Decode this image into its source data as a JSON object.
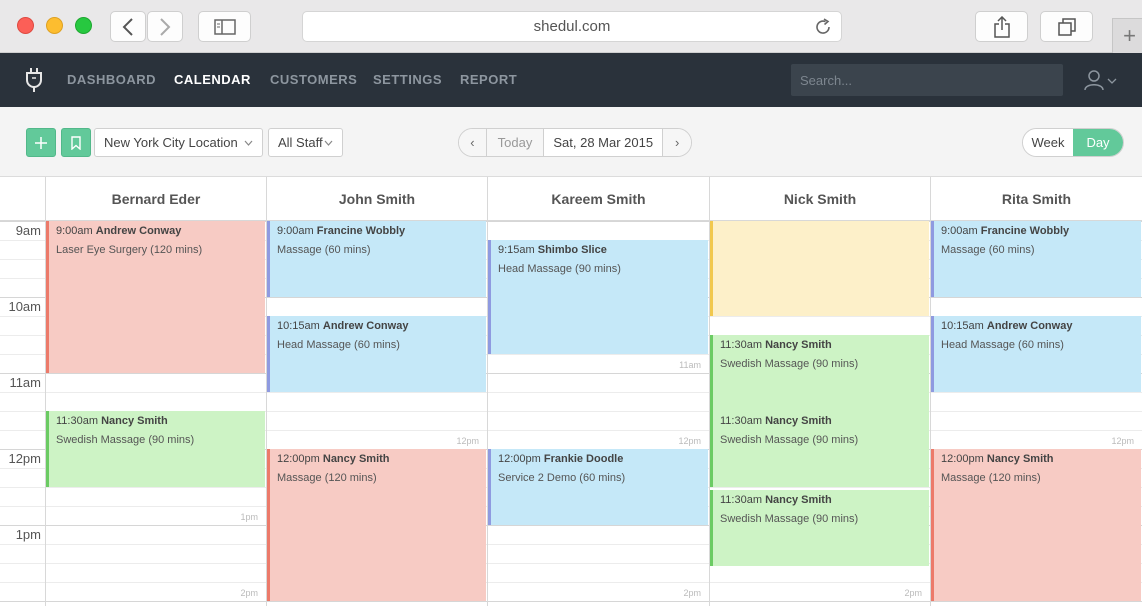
{
  "browser": {
    "url": "shedul.com"
  },
  "nav": {
    "items": [
      {
        "label": "DASHBOARD",
        "active": false
      },
      {
        "label": "CALENDAR",
        "active": true
      },
      {
        "label": "CUSTOMERS",
        "active": false
      },
      {
        "label": "SETTINGS",
        "active": false
      },
      {
        "label": "REPORT",
        "active": false
      }
    ],
    "search_placeholder": "Search..."
  },
  "toolbar": {
    "add_icon": "plus-icon",
    "bookmark_icon": "bookmark-icon",
    "location": "New York City Location",
    "staff": "All Staff",
    "prev": "‹",
    "today": "Today",
    "date": "Sat, 28 Mar 2015",
    "next": "›",
    "view_week": "Week",
    "view_day": "Day",
    "active_view": "Day"
  },
  "colors": {
    "accent": "#62c99a",
    "nav_bg": "#2a323b",
    "red": "#f7cbc4",
    "blue": "#c5e8f8",
    "green": "#cdf3c5",
    "yellow": "#fdf0c9"
  },
  "calendar": {
    "staff": [
      "Bernard Eder",
      "John Smith",
      "Kareem Smith",
      "Nick Smith",
      "Rita Smith"
    ],
    "hours": [
      "9am",
      "10am",
      "11am",
      "12pm",
      "1pm",
      "2pm"
    ],
    "appointments": [
      {
        "staff": 0,
        "start": "9:00am",
        "customer": "Andrew Conway",
        "service": "Laser Eye Surgery (120 mins)",
        "color": "red",
        "start_min": 0,
        "duration": 120
      },
      {
        "staff": 0,
        "start": "11:30am",
        "customer": "Nancy Smith",
        "service": "Swedish Massage (90 mins)",
        "color": "green",
        "start_min": 150,
        "duration": 60
      },
      {
        "staff": 1,
        "start": "9:00am",
        "customer": "Francine Wobbly",
        "service": "Massage (60 mins)",
        "color": "blue",
        "start_min": 0,
        "duration": 60
      },
      {
        "staff": 1,
        "start": "10:15am",
        "customer": "Andrew Conway",
        "service": "Head Massage (60 mins)",
        "color": "blue",
        "start_min": 75,
        "duration": 60
      },
      {
        "staff": 1,
        "start": "12:00pm",
        "customer": "Nancy Smith",
        "service": "Massage (120 mins)",
        "color": "red",
        "start_min": 180,
        "duration": 120
      },
      {
        "staff": 2,
        "start": "9:15am",
        "customer": "Shimbo Slice",
        "service": "Head Massage (90 mins)",
        "color": "blue",
        "start_min": 15,
        "duration": 90
      },
      {
        "staff": 2,
        "start": "12:00pm",
        "customer": "Frankie Doodle",
        "service": "Service 2 Demo (60 mins)",
        "color": "blue",
        "start_min": 180,
        "duration": 60
      },
      {
        "staff": 3,
        "start": "",
        "customer": "",
        "service": "",
        "color": "yellow",
        "start_min": 0,
        "duration": 75
      },
      {
        "staff": 3,
        "start": "11:30am",
        "customer": "Nancy Smith",
        "service": "Swedish Massage (90 mins)",
        "color": "green",
        "start_min": 90,
        "duration": 60
      },
      {
        "staff": 3,
        "start": "11:30am",
        "customer": "Nancy Smith",
        "service": "Swedish Massage (90 mins)",
        "color": "green",
        "start_min": 150,
        "duration": 60
      },
      {
        "staff": 3,
        "start": "11:30am",
        "customer": "Nancy Smith",
        "service": "Swedish Massage (90 mins)",
        "color": "green",
        "start_min": 212,
        "duration": 60
      },
      {
        "staff": 4,
        "start": "9:00am",
        "customer": "Francine Wobbly",
        "service": "Massage (60 mins)",
        "color": "blue",
        "start_min": 0,
        "duration": 60
      },
      {
        "staff": 4,
        "start": "10:15am",
        "customer": "Andrew Conway",
        "service": "Head Massage (60 mins)",
        "color": "blue",
        "start_min": 75,
        "duration": 60
      },
      {
        "staff": 4,
        "start": "12:00pm",
        "customer": "Nancy Smith",
        "service": "Massage (120 mins)",
        "color": "red",
        "start_min": 180,
        "duration": 120
      }
    ]
  }
}
